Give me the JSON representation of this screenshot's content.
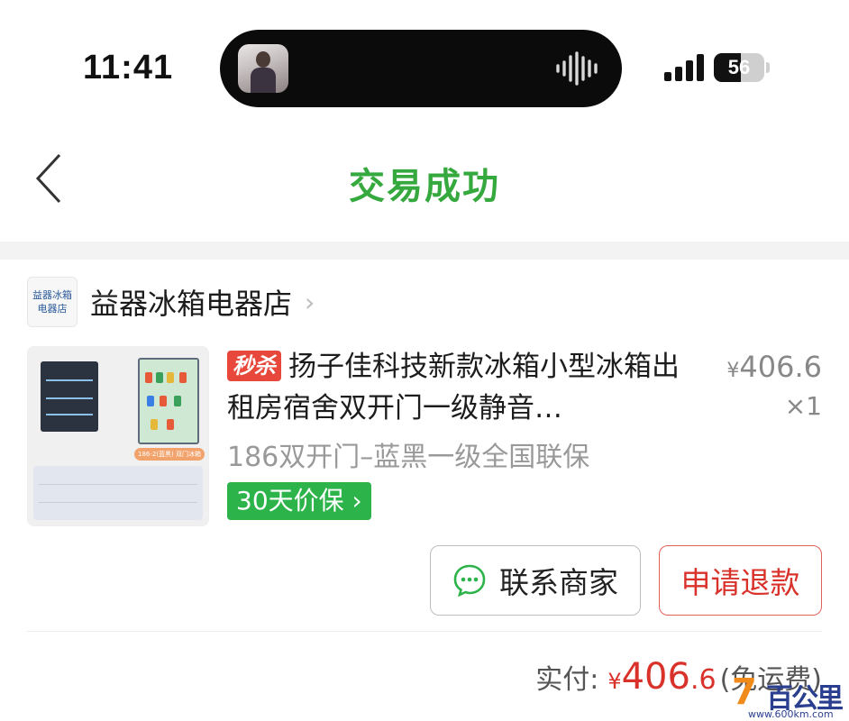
{
  "status_bar": {
    "time": "11:41",
    "battery": "56",
    "battery_level_percent": 56
  },
  "nav": {
    "title": "交易成功",
    "title_color": "#35a93e"
  },
  "shop": {
    "logo_text_line1": "益器冰箱",
    "logo_text_line2": "电器店",
    "name": "益器冰箱电器店"
  },
  "product": {
    "flash_tag": "秒杀",
    "title": "扬子佳科技新款冰箱小型冰箱出租房宿舍双开门一级静音…",
    "price_yen": "¥",
    "price": "406.6",
    "quantity": "×1",
    "spec": "186双开门–蓝黑一级全国联保",
    "guarantee": "30天价保",
    "thumbnail_badge": "186-2(蓝黑) 双门冰箱"
  },
  "actions": {
    "contact_label": "联系商家",
    "refund_label": "申请退款"
  },
  "total": {
    "label": "实付:",
    "yen": "¥",
    "int_part": "406",
    "dec_part": ".6",
    "note": "(免运费)"
  },
  "watermark": {
    "text": "百公里",
    "url": "www.600km.com"
  },
  "colors": {
    "accent_green": "#35a93e",
    "guarantee_green": "#2cb34a",
    "price_red": "#d9322b",
    "flash_red": "#e8473b"
  }
}
